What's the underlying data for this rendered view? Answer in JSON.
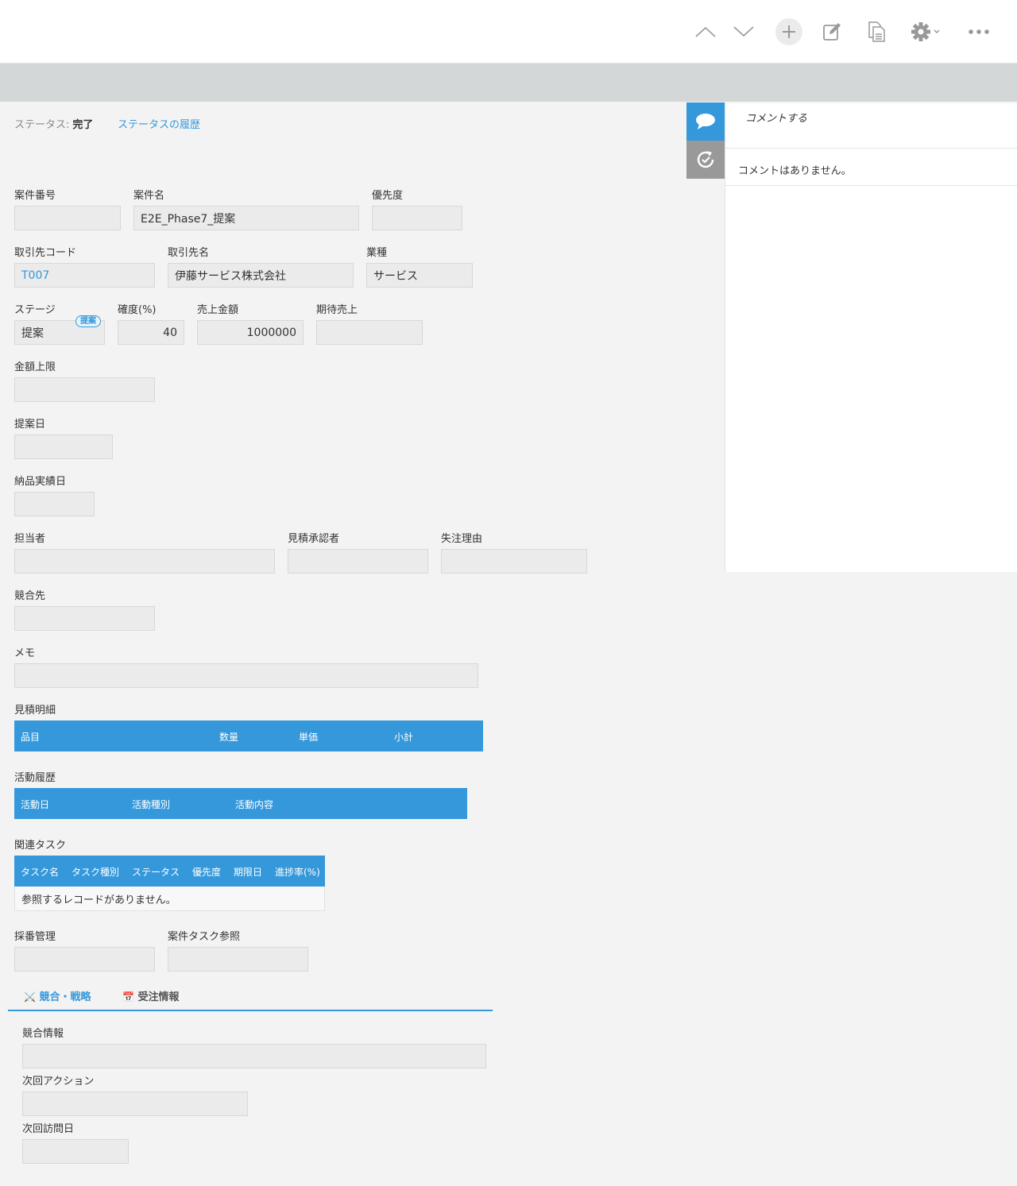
{
  "toolbar": {
    "icons": [
      "chevron-up-icon",
      "chevron-down-icon",
      "plus-icon",
      "edit-icon",
      "duplicate-icon",
      "gear-icon",
      "more-icon"
    ]
  },
  "status": {
    "label": "ステータス:",
    "value": "完了",
    "history_link": "ステータスの履歴"
  },
  "fields": {
    "case_number": {
      "label": "案件番号",
      "value": ""
    },
    "case_name": {
      "label": "案件名",
      "value": "E2E_Phase7_提案"
    },
    "priority": {
      "label": "優先度",
      "value": ""
    },
    "client_code": {
      "label": "取引先コード",
      "value": "T007"
    },
    "client_name": {
      "label": "取引先名",
      "value": "伊藤サービス株式会社"
    },
    "industry": {
      "label": "業種",
      "value": "サービス"
    },
    "stage": {
      "label": "ステージ",
      "value": "提案",
      "badge": "提案"
    },
    "probability": {
      "label": "確度(%)",
      "value": "40"
    },
    "sales_amount": {
      "label": "売上金額",
      "value": "1000000"
    },
    "expected_sales": {
      "label": "期待売上",
      "value": ""
    },
    "amount_limit": {
      "label": "金額上限",
      "value": ""
    },
    "proposal_date": {
      "label": "提案日",
      "value": ""
    },
    "delivery_date": {
      "label": "納品実績日",
      "value": ""
    },
    "assignee": {
      "label": "担当者",
      "value": ""
    },
    "estimate_approver": {
      "label": "見積承認者",
      "value": ""
    },
    "loss_reason": {
      "label": "失注理由",
      "value": ""
    },
    "competitor": {
      "label": "競合先",
      "value": ""
    },
    "memo": {
      "label": "メモ",
      "value": ""
    },
    "numbering": {
      "label": "採番管理",
      "value": ""
    },
    "case_task_ref": {
      "label": "案件タスク参照",
      "value": ""
    },
    "competition_info": {
      "label": "競合情報",
      "value": ""
    },
    "next_action": {
      "label": "次回アクション",
      "value": ""
    },
    "next_visit_date": {
      "label": "次回訪問日",
      "value": ""
    }
  },
  "estimate_table": {
    "title": "見積明細",
    "columns": [
      "品目",
      "数量",
      "単価",
      "小計"
    ]
  },
  "activity_table": {
    "title": "活動履歴",
    "columns": [
      "活動日",
      "活動種別",
      "活動内容"
    ]
  },
  "task_table": {
    "title": "関連タスク",
    "columns": [
      "タスク名",
      "タスク種別",
      "ステータス",
      "優先度",
      "期限日",
      "進捗率(%)"
    ],
    "empty_message": "参照するレコードがありません。"
  },
  "tabs": [
    {
      "icon": "⚔️",
      "label": "競合・戦略",
      "active": true
    },
    {
      "icon": "📅",
      "label": "受注情報",
      "active": false
    }
  ],
  "comments": {
    "input_placeholder": "コメントする",
    "empty_message": "コメントはありません。"
  },
  "colors": {
    "accent": "#3498db",
    "field_bg": "#ebebeb",
    "page_bg": "#f3f3f3"
  }
}
